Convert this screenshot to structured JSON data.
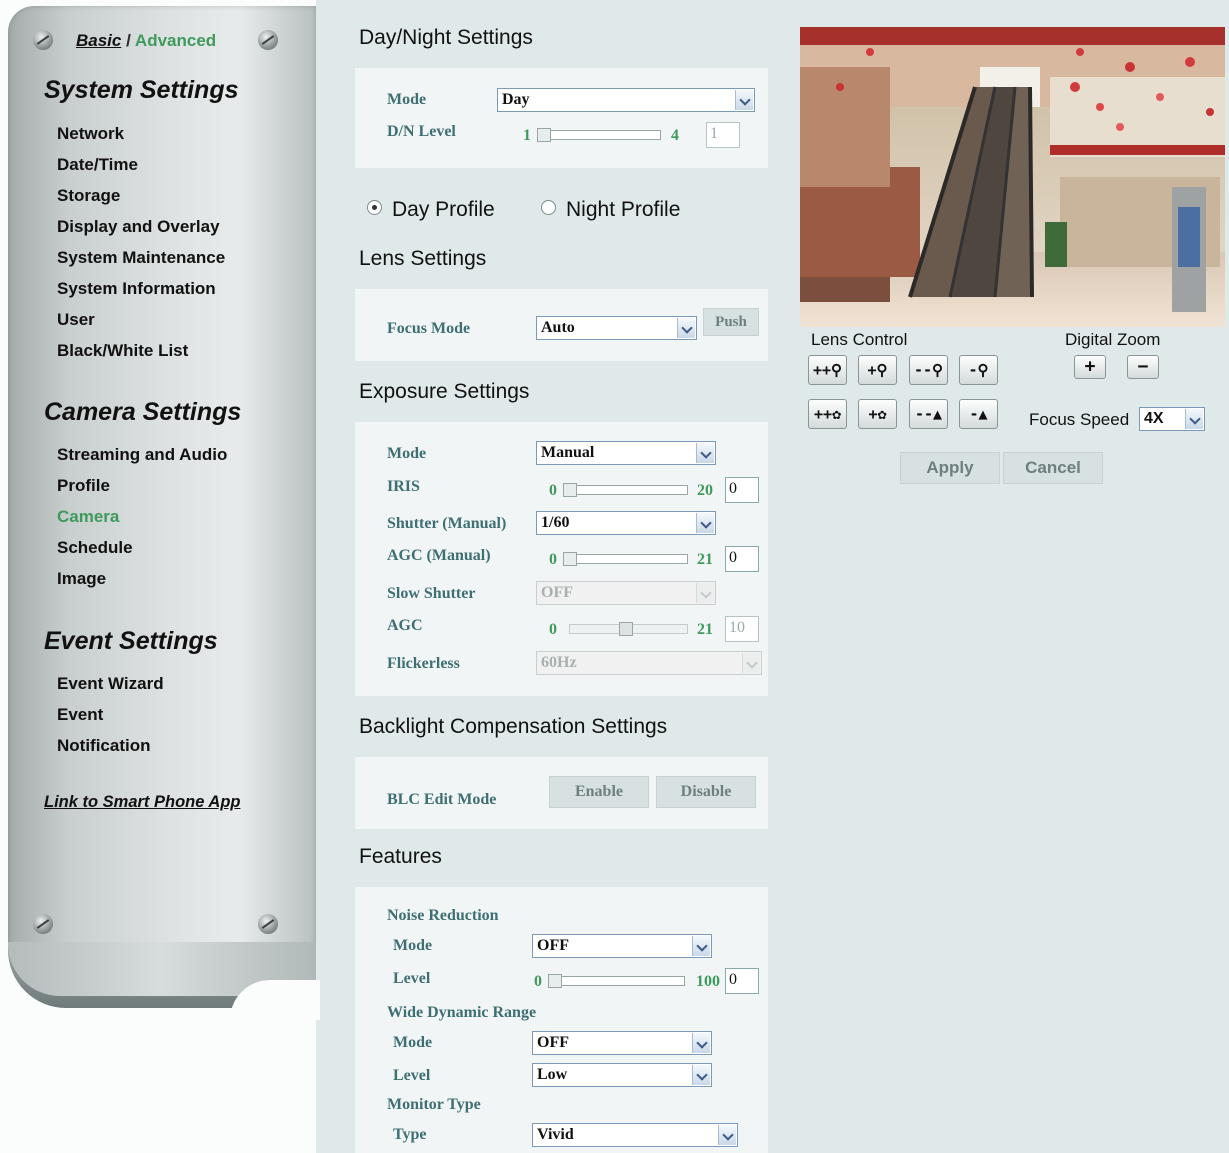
{
  "sidebar": {
    "basic_label": "Basic",
    "separator": " / ",
    "advanced_label": "Advanced",
    "sections": [
      {
        "title": "System Settings",
        "items": [
          "Network",
          "Date/Time",
          "Storage",
          "Display and Overlay",
          "System Maintenance",
          "System Information",
          "User",
          "Black/White List"
        ]
      },
      {
        "title": "Camera Settings",
        "items": [
          "Streaming and Audio",
          "Profile",
          "Camera",
          "Schedule",
          "Image"
        ]
      },
      {
        "title": "Event Settings",
        "items": [
          "Event Wizard",
          "Event",
          "Notification"
        ]
      }
    ],
    "active_item": "Camera",
    "app_link": "Link to Smart Phone App"
  },
  "daynight": {
    "title": "Day/Night Settings",
    "mode_label": "Mode",
    "mode_value": "Day",
    "dn_level_label": "D/N Level",
    "dn_min": "1",
    "dn_max": "4",
    "dn_value": "1"
  },
  "profiles": {
    "day": "Day Profile",
    "night": "Night Profile",
    "selected": "Day Profile"
  },
  "lens": {
    "title": "Lens Settings",
    "focus_mode_label": "Focus Mode",
    "focus_mode_value": "Auto",
    "push_label": "Push"
  },
  "exposure": {
    "title": "Exposure Settings",
    "mode_label": "Mode",
    "mode_value": "Manual",
    "iris_label": "IRIS",
    "iris_min": "0",
    "iris_max": "20",
    "iris_value": "0",
    "shutter_label": "Shutter (Manual)",
    "shutter_value": "1/60",
    "agc_manual_label": "AGC (Manual)",
    "agc_manual_min": "0",
    "agc_manual_max": "21",
    "agc_manual_value": "0",
    "slow_shutter_label": "Slow Shutter",
    "slow_shutter_value": "OFF",
    "agc_label": "AGC",
    "agc_min": "0",
    "agc_max": "21",
    "agc_value": "10",
    "flickerless_label": "Flickerless",
    "flickerless_value": "60Hz"
  },
  "blc": {
    "title": "Backlight Compensation Settings",
    "edit_mode_label": "BLC Edit Mode",
    "enable_label": "Enable",
    "disable_label": "Disable"
  },
  "features": {
    "title": "Features",
    "nr_title": "Noise Reduction",
    "nr_mode_label": "Mode",
    "nr_mode_value": "OFF",
    "nr_level_label": "Level",
    "nr_level_min": "0",
    "nr_level_max": "100",
    "nr_level_value": "0",
    "wdr_title": "Wide Dynamic Range",
    "wdr_mode_label": "Mode",
    "wdr_mode_value": "OFF",
    "wdr_level_label": "Level",
    "wdr_level_value": "Low",
    "monitor_title": "Monitor Type",
    "monitor_type_label": "Type",
    "monitor_type_value": "Vivid"
  },
  "controls": {
    "lens_control_label": "Lens Control",
    "digital_zoom_label": "Digital Zoom",
    "focus_speed_label": "Focus Speed",
    "focus_speed_value": "4X",
    "apply_label": "Apply",
    "cancel_label": "Cancel"
  },
  "colors": {
    "accent_green": "#3f9a5c",
    "label_teal": "#3d6f73",
    "panel_bg": "#dfe9e9"
  }
}
